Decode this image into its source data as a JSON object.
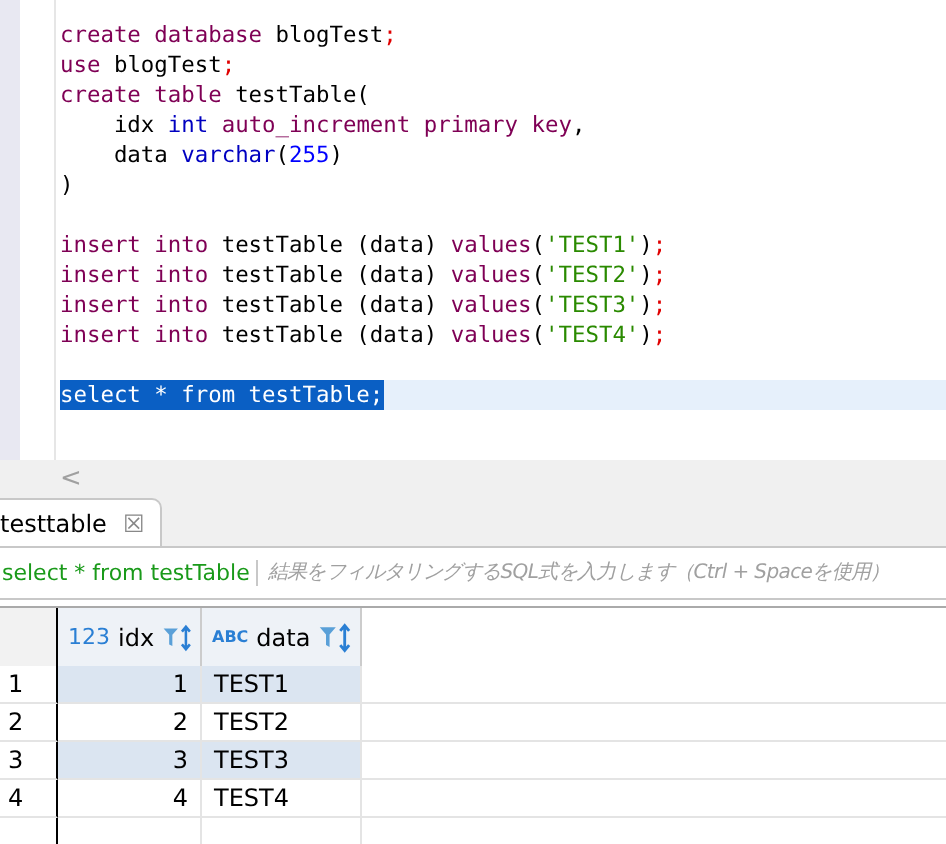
{
  "editor": {
    "lines": [
      {
        "selected": false,
        "tokens": [
          {
            "t": "create database",
            "color": "#7f0055"
          },
          {
            "t": " blogTest",
            "color": "#000000"
          },
          {
            "t": ";",
            "color": "#e00000"
          }
        ]
      },
      {
        "selected": false,
        "tokens": [
          {
            "t": "use",
            "color": "#7f0055"
          },
          {
            "t": " blogTest",
            "color": "#000000"
          },
          {
            "t": ";",
            "color": "#e00000"
          }
        ]
      },
      {
        "selected": false,
        "tokens": [
          {
            "t": "create table",
            "color": "#7f0055"
          },
          {
            "t": " testTable(",
            "color": "#000000"
          }
        ]
      },
      {
        "selected": false,
        "tokens": [
          {
            "t": "    idx ",
            "color": "#000000"
          },
          {
            "t": "int",
            "color": "#0000c0"
          },
          {
            "t": " auto_increment primary key",
            "color": "#7f0055"
          },
          {
            "t": ",",
            "color": "#000000"
          }
        ]
      },
      {
        "selected": false,
        "tokens": [
          {
            "t": "    data ",
            "color": "#000000"
          },
          {
            "t": "varchar",
            "color": "#0000c0"
          },
          {
            "t": "(",
            "color": "#000000"
          },
          {
            "t": "255",
            "color": "#0000ff"
          },
          {
            "t": ")",
            "color": "#000000"
          }
        ]
      },
      {
        "selected": false,
        "tokens": [
          {
            "t": ")",
            "color": "#000000"
          }
        ]
      },
      {
        "selected": false
      },
      {
        "selected": false,
        "tokens": [
          {
            "t": "insert into",
            "color": "#7f0055"
          },
          {
            "t": " testTable (data) ",
            "color": "#000000"
          },
          {
            "t": "values",
            "color": "#7f0055"
          },
          {
            "t": "(",
            "color": "#000000"
          },
          {
            "t": "'TEST1'",
            "color": "#2a8a00"
          },
          {
            "t": ")",
            "color": "#000000"
          },
          {
            "t": ";",
            "color": "#e00000"
          }
        ]
      },
      {
        "selected": false,
        "tokens": [
          {
            "t": "insert into",
            "color": "#7f0055"
          },
          {
            "t": " testTable (data) ",
            "color": "#000000"
          },
          {
            "t": "values",
            "color": "#7f0055"
          },
          {
            "t": "(",
            "color": "#000000"
          },
          {
            "t": "'TEST2'",
            "color": "#2a8a00"
          },
          {
            "t": ")",
            "color": "#000000"
          },
          {
            "t": ";",
            "color": "#e00000"
          }
        ]
      },
      {
        "selected": false,
        "tokens": [
          {
            "t": "insert into",
            "color": "#7f0055"
          },
          {
            "t": " testTable (data) ",
            "color": "#000000"
          },
          {
            "t": "values",
            "color": "#7f0055"
          },
          {
            "t": "(",
            "color": "#000000"
          },
          {
            "t": "'TEST3'",
            "color": "#2a8a00"
          },
          {
            "t": ")",
            "color": "#000000"
          },
          {
            "t": ";",
            "color": "#e00000"
          }
        ]
      },
      {
        "selected": false,
        "tokens": [
          {
            "t": "insert into",
            "color": "#7f0055"
          },
          {
            "t": " testTable (data) ",
            "color": "#000000"
          },
          {
            "t": "values",
            "color": "#7f0055"
          },
          {
            "t": "(",
            "color": "#000000"
          },
          {
            "t": "'TEST4'",
            "color": "#2a8a00"
          },
          {
            "t": ")",
            "color": "#000000"
          },
          {
            "t": ";",
            "color": "#e00000"
          }
        ]
      },
      {
        "selected": false
      },
      {
        "selected": true,
        "text": "select * from testTable;"
      }
    ]
  },
  "scroll_left": "<",
  "tab": {
    "label": "testtable",
    "close": "☒"
  },
  "filter": {
    "query": "select * from testTable",
    "placeholder": "結果をフィルタリングするSQL式を入力します（Ctrl + Spaceを使用）"
  },
  "table": {
    "columns": [
      {
        "type_label": "123",
        "name": "idx"
      },
      {
        "type_label": "ABC",
        "name": "data"
      }
    ],
    "rows": [
      {
        "number": "1",
        "cells": [
          "1",
          "TEST1"
        ]
      },
      {
        "number": "2",
        "cells": [
          "2",
          "TEST2"
        ]
      },
      {
        "number": "3",
        "cells": [
          "3",
          "TEST3"
        ]
      },
      {
        "number": "4",
        "cells": [
          "4",
          "TEST4"
        ]
      }
    ]
  }
}
